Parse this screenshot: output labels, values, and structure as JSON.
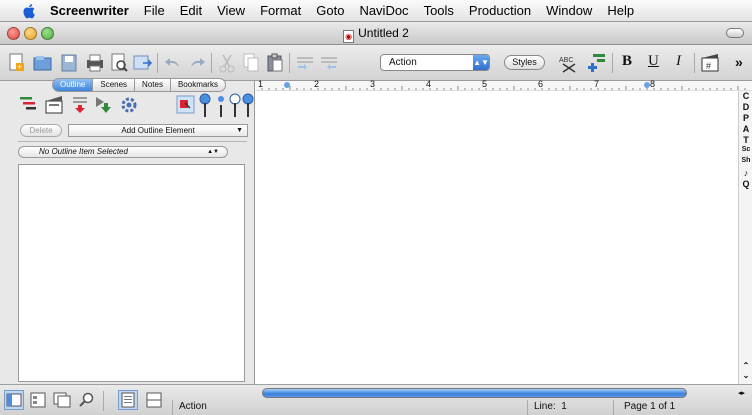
{
  "menubar": {
    "app_name": "Screenwriter",
    "items": [
      "File",
      "Edit",
      "View",
      "Format",
      "Goto",
      "NaviDoc",
      "Tools",
      "Production",
      "Window",
      "Help"
    ]
  },
  "window": {
    "title": "Untitled 2",
    "traffic_lights": {
      "close": "#e0443e",
      "minimize": "#e6a220",
      "zoom": "#4aab3c"
    }
  },
  "toolbar": {
    "element_value": "Action",
    "styles_label": "Styles",
    "bold": "B",
    "underline": "U",
    "italic": "I",
    "icons": [
      "new-document-icon",
      "open-document-icon",
      "save-document-icon",
      "print-icon",
      "print-preview-icon",
      "export-icon",
      "undo-icon",
      "redo-icon",
      "cut-icon",
      "copy-icon",
      "paste-icon",
      "indent-left-icon",
      "indent-right-icon",
      "spelling-icon",
      "add-element-icon",
      "scene-number-icon"
    ]
  },
  "sidebar": {
    "tabs": [
      "Outline",
      "Scenes",
      "Notes",
      "Bookmarks"
    ],
    "active_tab": "Outline",
    "delete_label": "Delete",
    "add_outline_label": "Add Outline Element",
    "outline_item_status": "No Outline Item Selected"
  },
  "ruler": {
    "numbers": [
      "1",
      "2",
      "3",
      "4",
      "5",
      "6",
      "7",
      "8"
    ]
  },
  "element_bar": {
    "letters": [
      "C",
      "D",
      "P",
      "A",
      "T",
      "Sc",
      "Sh",
      "♪",
      "Q"
    ]
  },
  "status": {
    "element": "Action",
    "line_label": "Line:",
    "line_value": "1",
    "page": "Page 1 of 1"
  },
  "colors": {
    "accent": "#3d85dd",
    "sidebar_bg": "#e8e8e8"
  }
}
